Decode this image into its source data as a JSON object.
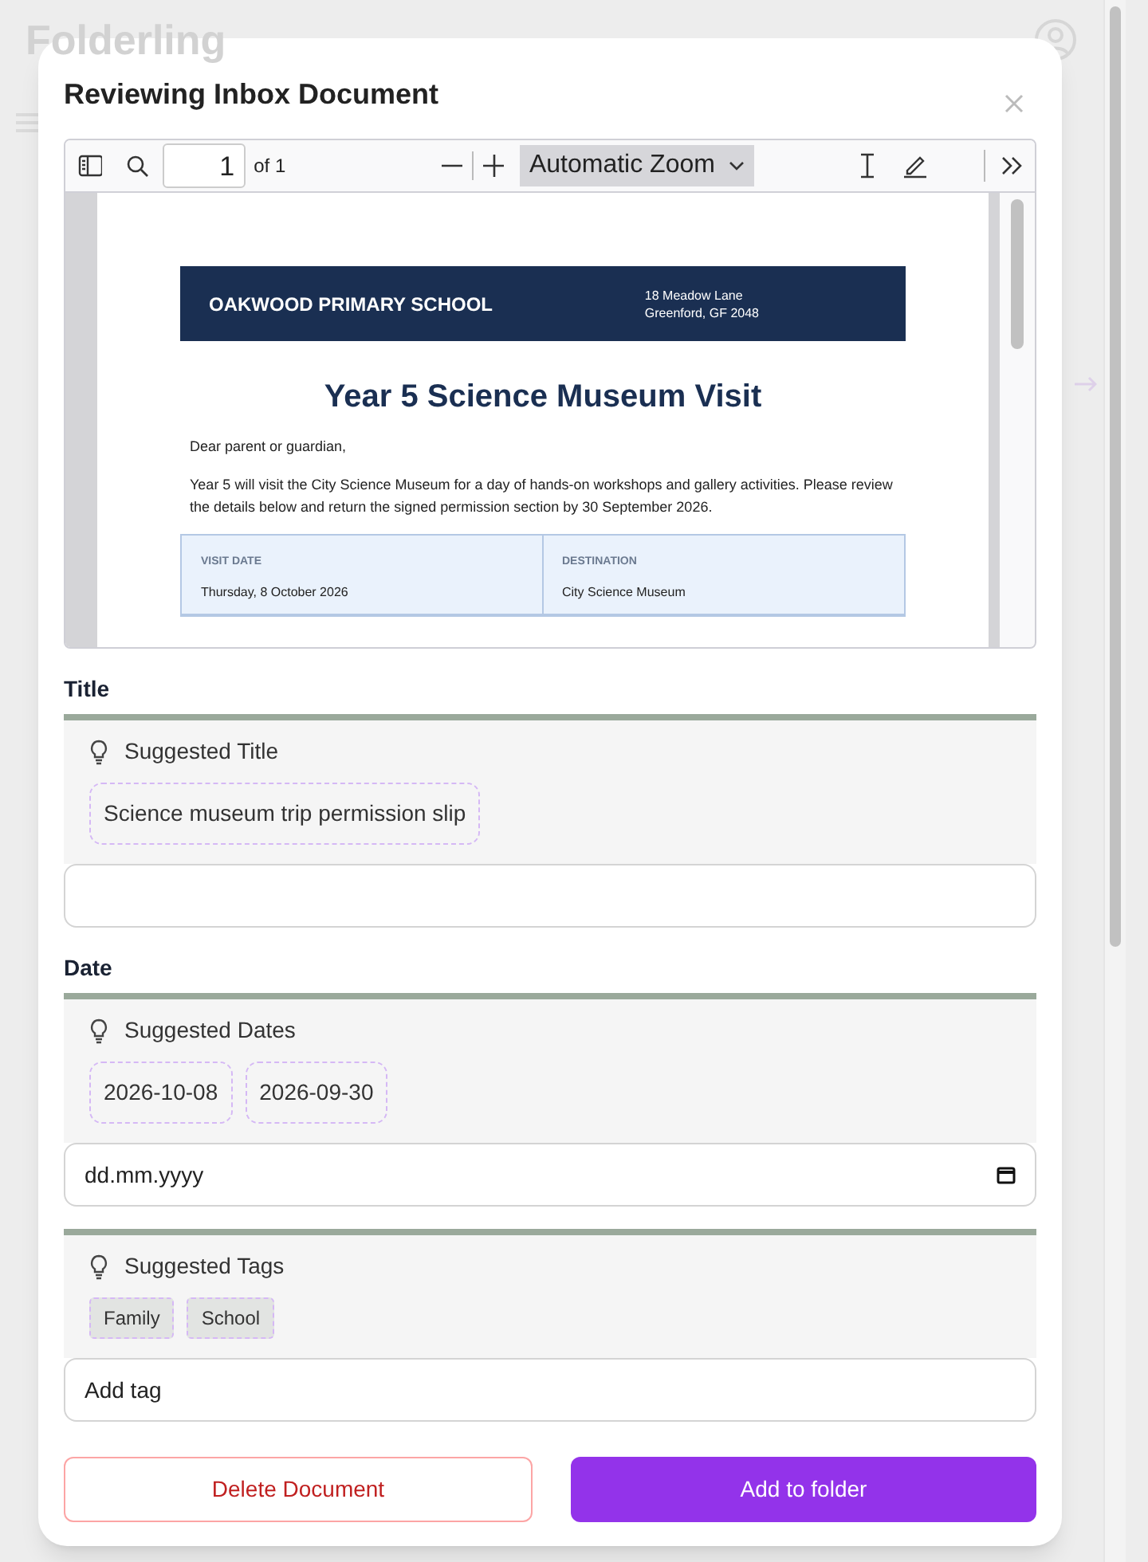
{
  "background": {
    "app_title": "Folderling"
  },
  "dialog": {
    "title": "Reviewing Inbox Document"
  },
  "pdf_viewer": {
    "page_number": "1",
    "page_count": "of 1",
    "zoom": "Automatic Zoom",
    "document": {
      "school": "OAKWOOD PRIMARY SCHOOL",
      "address": [
        "18 Meadow Lane",
        "Greenford, GF 2048"
      ],
      "heading": "Year 5 Science Museum Visit",
      "greeting": "Dear parent or guardian,",
      "body": "Year 5 will visit the City Science Museum for a day of hands-on workshops and gallery activities. Please review the details below and return the signed permission section by 30 September 2026.",
      "details": [
        {
          "label": "VISIT DATE",
          "value": "Thursday, 8 October 2026"
        },
        {
          "label": "DESTINATION",
          "value": "City Science Museum"
        }
      ]
    }
  },
  "sections": [
    {
      "kind": "title",
      "label": "Title",
      "suggestion_heading": "Suggested Title",
      "suggestions": [
        "Science museum trip permission slip"
      ]
    },
    {
      "kind": "date",
      "label": "Date",
      "suggestion_heading": "Suggested Dates",
      "suggestions": [
        "2026-10-08",
        "2026-09-30"
      ],
      "placeholder": "dd.mm.yyyy"
    },
    {
      "kind": "tags",
      "suggestion_heading": "Suggested Tags",
      "suggestions": [
        "Family",
        "School"
      ],
      "placeholder": "Add tag"
    }
  ],
  "buttons": [
    {
      "kind": "danger",
      "label": "Delete Document"
    },
    {
      "kind": "primary",
      "label": "Add to folder"
    }
  ]
}
